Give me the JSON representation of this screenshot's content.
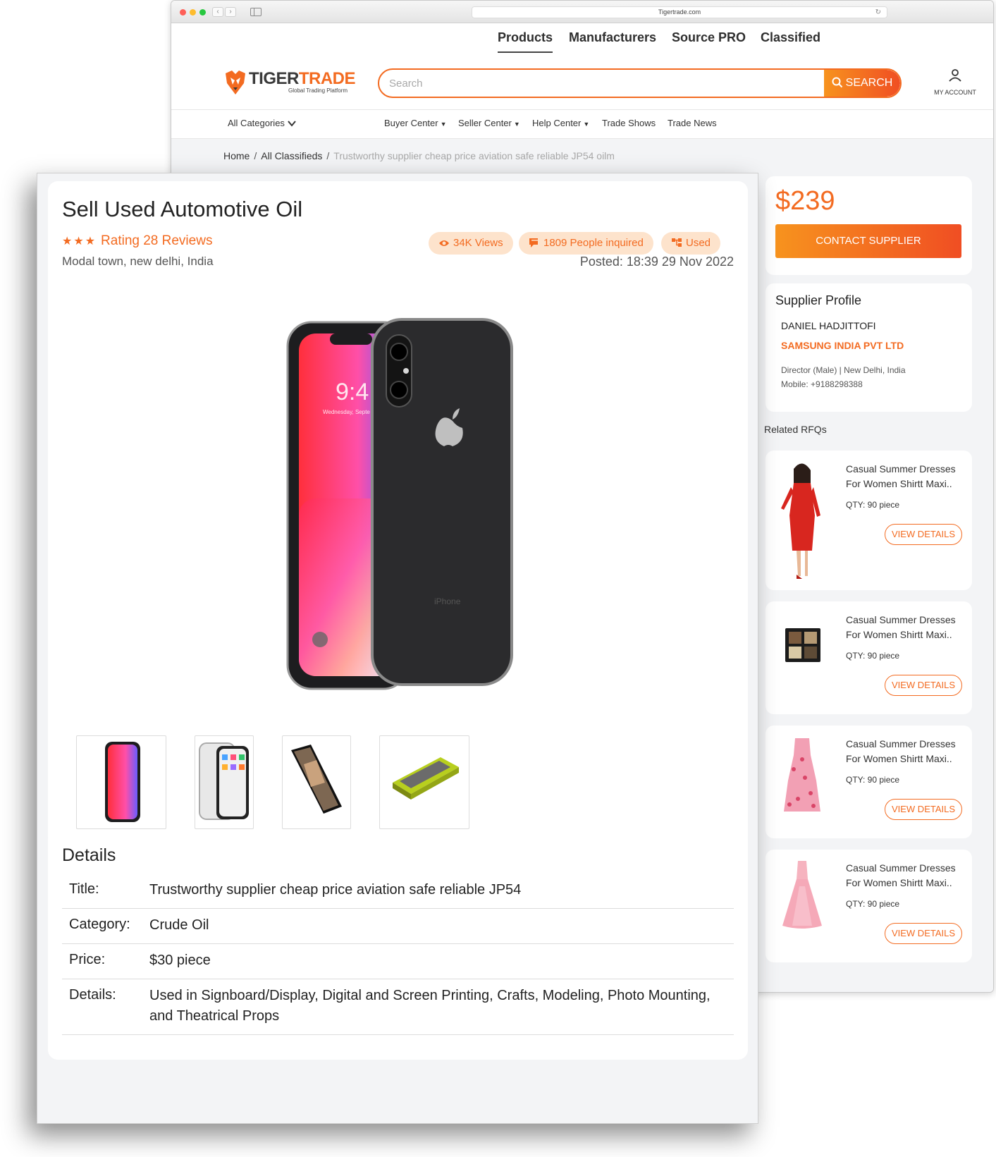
{
  "browser": {
    "url": "Tigertrade.com"
  },
  "top_nav": {
    "items": [
      "Products",
      "Manufacturers",
      "Source PRO",
      "Classified"
    ]
  },
  "logo": {
    "text_dark": "TIGER",
    "text_accent": "TRADE",
    "tagline": "Global Trading Platform"
  },
  "search": {
    "placeholder": "Search",
    "button_label": "SEARCH"
  },
  "account": {
    "label": "MY ACCOUNT"
  },
  "sub_nav": {
    "categories": "All Categories",
    "items": [
      "Buyer Center",
      "Seller Center",
      "Help Center",
      "Trade Shows",
      "Trade News"
    ]
  },
  "breadcrumb": {
    "home": "Home",
    "section": "All Classifieds",
    "current": "Trustworthy supplier cheap price aviation safe reliable JP54 oilm"
  },
  "listing": {
    "title": "Sell Used Automotive Oil",
    "stars": "★★★",
    "rating_text": "Rating 28 Reviews",
    "location": "Modal town, new delhi, India",
    "views": "34K Views",
    "inquired": "1809 People inquired",
    "condition": "Used",
    "posted": "Posted: 18:39 29 Nov 2022"
  },
  "price_box": {
    "price": "$239",
    "contact_label": "CONTACT SUPPLIER"
  },
  "supplier": {
    "heading": "Supplier Profile",
    "name": "DANIEL HADJITTOFI",
    "company": "SAMSUNG INDIA PVT LTD",
    "role": "Director (Male) | New Delhi, India",
    "mobile": "Mobile: +9188298388"
  },
  "related": {
    "heading": "Related RFQs",
    "items": [
      {
        "name": "Casual Summer Dresses For Women Shirtt Maxi..",
        "qty": "QTY: 90 piece",
        "button": "VIEW DETAILS",
        "image": "red-dress-model"
      },
      {
        "name": "Casual Summer Dresses For Women Shirtt Maxi..",
        "qty": "QTY: 90 piece",
        "button": "VIEW DETAILS",
        "image": "eyeshadow-palette"
      },
      {
        "name": "Casual Summer Dresses For Women Shirtt Maxi..",
        "qty": "QTY: 90 piece",
        "button": "VIEW DETAILS",
        "image": "floral-dress"
      },
      {
        "name": "Casual Summer Dresses For Women Shirtt Maxi..",
        "qty": "QTY: 90 piece",
        "button": "VIEW DETAILS",
        "image": "pink-gown"
      }
    ]
  },
  "details": {
    "heading": "Details",
    "rows": [
      {
        "label": "Title:",
        "value": "Trustworthy supplier cheap price aviation safe reliable JP54"
      },
      {
        "label": "Category:",
        "value": "Crude Oil"
      },
      {
        "label": "Price:",
        "value": "$30 piece"
      },
      {
        "label": "Details:",
        "value": "Used in Signboard/Display, Digital and Screen Printing, Crafts, Modeling, Photo Mounting, and Theatrical Props"
      }
    ]
  },
  "colors": {
    "brand_orange": "#f36b21",
    "gradient_start": "#f7931e",
    "gradient_end": "#f04e23",
    "badge_bg": "#fde3cc"
  }
}
